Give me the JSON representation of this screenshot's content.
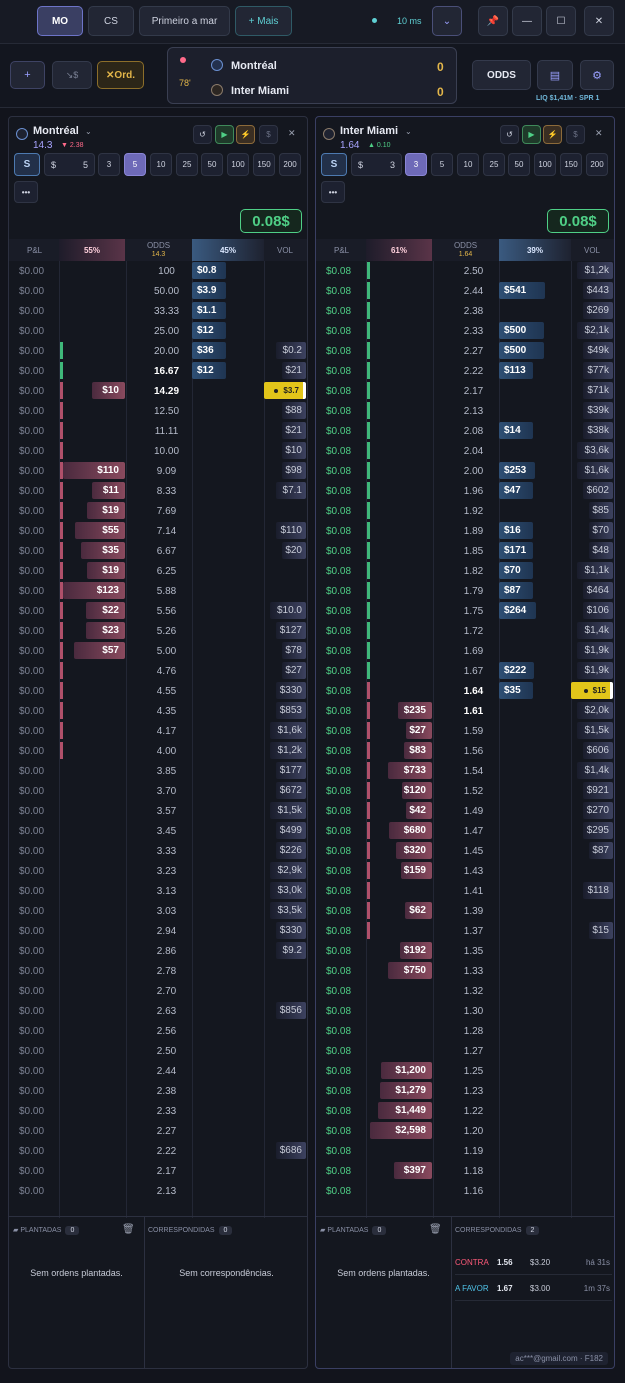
{
  "topbar": {
    "tabs": [
      "MO",
      "CS",
      "Primeiro a mar"
    ],
    "more": "+ Mais",
    "latency": "10 ms"
  },
  "subbar": {
    "add": "+",
    "trend": "↘$",
    "orders": "✕Ord.",
    "odds": "ODDS",
    "minute": "78'",
    "home": "Montréal",
    "away": "Inter Miami",
    "home_score": "0",
    "away_score": "0",
    "liq": "LIQ $1,41M · SPR 1"
  },
  "left": {
    "team": "Montréal",
    "price": "14.3",
    "change": "▼ 2.38",
    "stake": "5",
    "quick": [
      "3",
      "5",
      "10",
      "25",
      "50",
      "100",
      "150",
      "200"
    ],
    "profit": "0.08$",
    "pl": "P&L",
    "lay_pct": "55%",
    "odds_label": "ODDS",
    "odds_sub": "14.3",
    "back_pct": "45%",
    "vol": "VOL",
    "rows": [
      [
        "$0.00",
        "100",
        "",
        "$0.8",
        "",
        ""
      ],
      [
        "$0.00",
        "50.00",
        "",
        "$3.9",
        "",
        ""
      ],
      [
        "$0.00",
        "33.33",
        "",
        "$1.1",
        "",
        ""
      ],
      [
        "$0.00",
        "25.00",
        "",
        "$12",
        "",
        ""
      ],
      [
        "$0.00",
        "20.00",
        "",
        "$36",
        "$0.2",
        "g"
      ],
      [
        "$0.00",
        "16.67",
        "",
        "$12",
        "$21",
        "g"
      ],
      [
        "$0.00",
        "14.29",
        "$10",
        "",
        "$3.7",
        "p"
      ],
      [
        "$0.00",
        "12.50",
        "",
        "",
        "$88",
        "p"
      ],
      [
        "$0.00",
        "11.11",
        "",
        "",
        "$21",
        "p"
      ],
      [
        "$0.00",
        "10.00",
        "",
        "",
        "$10",
        "p"
      ],
      [
        "$0.00",
        "9.09",
        "$110",
        "",
        "$98",
        "p"
      ],
      [
        "$0.00",
        "8.33",
        "$11",
        "",
        "$7.1",
        "p"
      ],
      [
        "$0.00",
        "7.69",
        "$19",
        "",
        "",
        "p"
      ],
      [
        "$0.00",
        "7.14",
        "$55",
        "",
        "$110",
        "p"
      ],
      [
        "$0.00",
        "6.67",
        "$35",
        "",
        "$20",
        "p"
      ],
      [
        "$0.00",
        "6.25",
        "$19",
        "",
        "",
        "p"
      ],
      [
        "$0.00",
        "5.88",
        "$123",
        "",
        "",
        "p"
      ],
      [
        "$0.00",
        "5.56",
        "$22",
        "",
        "$10.0",
        "p"
      ],
      [
        "$0.00",
        "5.26",
        "$23",
        "",
        "$127",
        "p"
      ],
      [
        "$0.00",
        "5.00",
        "$57",
        "",
        "$78",
        "p"
      ],
      [
        "$0.00",
        "4.76",
        "",
        "",
        "$27",
        "p"
      ],
      [
        "$0.00",
        "4.55",
        "",
        "",
        "$330",
        "p"
      ],
      [
        "$0.00",
        "4.35",
        "",
        "",
        "$853",
        "p"
      ],
      [
        "$0.00",
        "4.17",
        "",
        "",
        "$1,6k",
        "p"
      ],
      [
        "$0.00",
        "4.00",
        "",
        "",
        "$1,2k",
        "p"
      ],
      [
        "$0.00",
        "3.85",
        "",
        "",
        "$177",
        ""
      ],
      [
        "$0.00",
        "3.70",
        "",
        "",
        "$672",
        ""
      ],
      [
        "$0.00",
        "3.57",
        "",
        "",
        "$1,5k",
        ""
      ],
      [
        "$0.00",
        "3.45",
        "",
        "",
        "$499",
        ""
      ],
      [
        "$0.00",
        "3.33",
        "",
        "",
        "$226",
        ""
      ],
      [
        "$0.00",
        "3.23",
        "",
        "",
        "$2,9k",
        ""
      ],
      [
        "$0.00",
        "3.13",
        "",
        "",
        "$3,0k",
        ""
      ],
      [
        "$0.00",
        "3.03",
        "",
        "",
        "$3,5k",
        ""
      ],
      [
        "$0.00",
        "2.94",
        "",
        "",
        "$330",
        ""
      ],
      [
        "$0.00",
        "2.86",
        "",
        "",
        "$9.2",
        ""
      ],
      [
        "$0.00",
        "2.78",
        "",
        "",
        "",
        ""
      ],
      [
        "$0.00",
        "2.70",
        "",
        "",
        "",
        ""
      ],
      [
        "$0.00",
        "2.63",
        "",
        "",
        "$856",
        ""
      ],
      [
        "$0.00",
        "2.56",
        "",
        "",
        "",
        ""
      ],
      [
        "$0.00",
        "2.50",
        "",
        "",
        "",
        ""
      ],
      [
        "$0.00",
        "2.44",
        "",
        "",
        "",
        ""
      ],
      [
        "$0.00",
        "2.38",
        "",
        "",
        "",
        ""
      ],
      [
        "$0.00",
        "2.33",
        "",
        "",
        "",
        ""
      ],
      [
        "$0.00",
        "2.27",
        "",
        "",
        "",
        ""
      ],
      [
        "$0.00",
        "2.22",
        "",
        "",
        "$686",
        ""
      ],
      [
        "$0.00",
        "2.17",
        "",
        "",
        "",
        ""
      ],
      [
        "$0.00",
        "2.13",
        "",
        "",
        "",
        ""
      ]
    ],
    "planted": "PLANTADAS",
    "planted_n": "0",
    "matched": "CORRESPONDIDAS",
    "matched_n": "0",
    "no_orders": "Sem ordens plantadas.",
    "no_match": "Sem correspondências."
  },
  "right": {
    "team": "Inter Miami",
    "price": "1.64",
    "change": "▲ 0.10",
    "stake": "3",
    "quick": [
      "3",
      "5",
      "10",
      "25",
      "50",
      "100",
      "150",
      "200"
    ],
    "profit": "0.08$",
    "pl": "P&L",
    "lay_pct": "61%",
    "odds_label": "ODDS",
    "odds_sub": "1.64",
    "back_pct": "39%",
    "vol": "VOL",
    "rows": [
      [
        "$0.08",
        "2.50",
        "",
        "",
        "$1,2k",
        "g"
      ],
      [
        "$0.08",
        "2.44",
        "",
        "$541",
        "$443",
        "g"
      ],
      [
        "$0.08",
        "2.38",
        "",
        "",
        "$269",
        "g"
      ],
      [
        "$0.08",
        "2.33",
        "",
        "$500",
        "$2,1k",
        "g"
      ],
      [
        "$0.08",
        "2.27",
        "",
        "$500",
        "$49k",
        "g"
      ],
      [
        "$0.08",
        "2.22",
        "",
        "$113",
        "$77k",
        "g"
      ],
      [
        "$0.08",
        "2.17",
        "",
        "",
        "$71k",
        "g"
      ],
      [
        "$0.08",
        "2.13",
        "",
        "",
        "$39k",
        "g"
      ],
      [
        "$0.08",
        "2.08",
        "",
        "$14",
        "$38k",
        "g"
      ],
      [
        "$0.08",
        "2.04",
        "",
        "",
        "$3,6k",
        "g"
      ],
      [
        "$0.08",
        "2.00",
        "",
        "$253",
        "$1,6k",
        "g"
      ],
      [
        "$0.08",
        "1.96",
        "",
        "$47",
        "$602",
        "g"
      ],
      [
        "$0.08",
        "1.92",
        "",
        "",
        "$85",
        "g"
      ],
      [
        "$0.08",
        "1.89",
        "",
        "$16",
        "$70",
        "g"
      ],
      [
        "$0.08",
        "1.85",
        "",
        "$171",
        "$48",
        "g"
      ],
      [
        "$0.08",
        "1.82",
        "",
        "$70",
        "$1,1k",
        "g"
      ],
      [
        "$0.08",
        "1.79",
        "",
        "$87",
        "$464",
        "g"
      ],
      [
        "$0.08",
        "1.75",
        "",
        "$264",
        "$106",
        "g"
      ],
      [
        "$0.08",
        "1.72",
        "",
        "",
        "$1,4k",
        "g"
      ],
      [
        "$0.08",
        "1.69",
        "",
        "",
        "$1,9k",
        "g"
      ],
      [
        "$0.08",
        "1.67",
        "",
        "$222",
        "$1,9k",
        "g"
      ],
      [
        "$0.08",
        "1.64",
        "",
        "$35",
        "$15",
        "p"
      ],
      [
        "$0.08",
        "1.61",
        "$235",
        "",
        "$2,0k",
        "p"
      ],
      [
        "$0.08",
        "1.59",
        "$27",
        "",
        "$1,5k",
        "p"
      ],
      [
        "$0.08",
        "1.56",
        "$83",
        "",
        "$606",
        "p"
      ],
      [
        "$0.08",
        "1.54",
        "$733",
        "",
        "$1,4k",
        "p"
      ],
      [
        "$0.08",
        "1.52",
        "$120",
        "",
        "$921",
        "p"
      ],
      [
        "$0.08",
        "1.49",
        "$42",
        "",
        "$270",
        "p"
      ],
      [
        "$0.08",
        "1.47",
        "$680",
        "",
        "$295",
        "p"
      ],
      [
        "$0.08",
        "1.45",
        "$320",
        "",
        "$87",
        "p"
      ],
      [
        "$0.08",
        "1.43",
        "$159",
        "",
        "",
        "p"
      ],
      [
        "$0.08",
        "1.41",
        "",
        "",
        "$118",
        "p"
      ],
      [
        "$0.08",
        "1.39",
        "$62",
        "",
        "",
        "p"
      ],
      [
        "$0.08",
        "1.37",
        "",
        "",
        "$15",
        "p"
      ],
      [
        "$0.08",
        "1.35",
        "$192",
        "",
        "",
        ""
      ],
      [
        "$0.08",
        "1.33",
        "$750",
        "",
        "",
        ""
      ],
      [
        "$0.08",
        "1.32",
        "",
        "",
        "",
        ""
      ],
      [
        "$0.08",
        "1.30",
        "",
        "",
        "",
        ""
      ],
      [
        "$0.08",
        "1.28",
        "",
        "",
        "",
        ""
      ],
      [
        "$0.08",
        "1.27",
        "",
        "",
        "",
        ""
      ],
      [
        "$0.08",
        "1.25",
        "$1,200",
        "",
        "",
        ""
      ],
      [
        "$0.08",
        "1.23",
        "$1,279",
        "",
        "",
        ""
      ],
      [
        "$0.08",
        "1.22",
        "$1,449",
        "",
        "",
        ""
      ],
      [
        "$0.08",
        "1.20",
        "$2,598",
        "",
        "",
        ""
      ],
      [
        "$0.08",
        "1.19",
        "",
        "",
        "",
        ""
      ],
      [
        "$0.08",
        "1.18",
        "$397",
        "",
        "",
        ""
      ],
      [
        "$0.08",
        "1.16",
        "",
        "",
        "",
        ""
      ]
    ],
    "planted": "PLANTADAS",
    "planted_n": "0",
    "matched": "CORRESPONDIDAS",
    "matched_n": "2",
    "no_orders": "Sem ordens plantadas.",
    "matches": [
      {
        "side": "CONTRA",
        "odds": "1.56",
        "amt": "$3.20",
        "ago": "há 31s",
        "color": "#ff5a7a"
      },
      {
        "side": "A FAVOR",
        "odds": "1.67",
        "amt": "$3.00",
        "ago": "1m 37s",
        "color": "#4fc3e8"
      }
    ],
    "account": "ac***@gmail.com · F182"
  },
  "colors": {
    "accent": "#6e6ab8",
    "profit": "#4fcf86",
    "back": "#2e4f74",
    "lay": "#8a4a5e",
    "current": "#e2c51a"
  }
}
